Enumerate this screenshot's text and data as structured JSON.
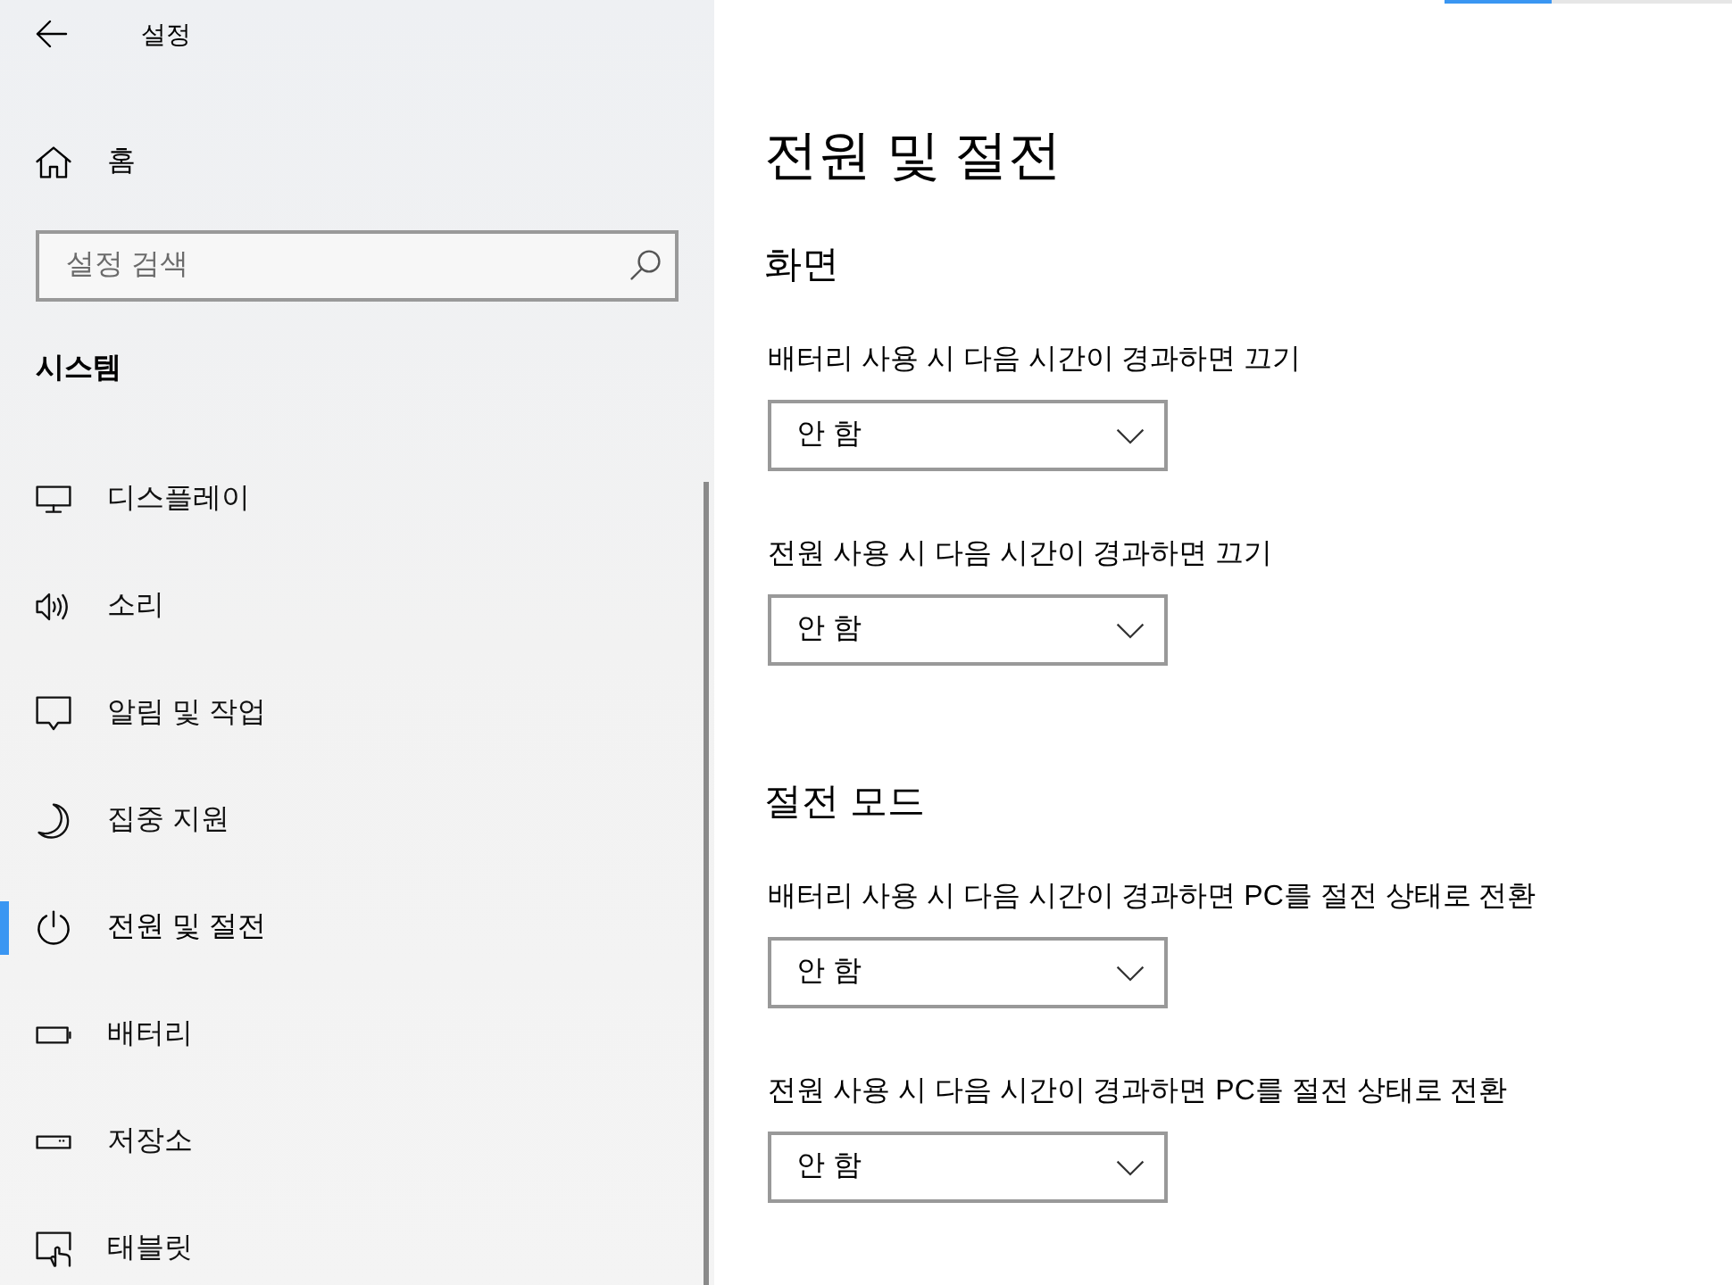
{
  "sidebar": {
    "title": "설정",
    "home": "홈",
    "search": {
      "placeholder": "설정 검색"
    },
    "section": "시스템",
    "items": [
      {
        "label": "디스플레이",
        "selected": false
      },
      {
        "label": "소리",
        "selected": false
      },
      {
        "label": "알림 및 작업",
        "selected": false
      },
      {
        "label": "집중 지원",
        "selected": false
      },
      {
        "label": "전원 및 절전",
        "selected": true
      },
      {
        "label": "배터리",
        "selected": false
      },
      {
        "label": "저장소",
        "selected": false
      },
      {
        "label": "태블릿",
        "selected": false
      }
    ]
  },
  "progress": {
    "level": 0.37
  },
  "page": {
    "title": "전원 및 절전",
    "sections": [
      {
        "heading": "화면",
        "settings": [
          {
            "label": "배터리 사용 시 다음 시간이 경과하면 끄기",
            "value": "안 함"
          },
          {
            "label": "전원 사용 시 다음 시간이 경과하면 끄기",
            "value": "안 함"
          }
        ]
      },
      {
        "heading": "절전 모드",
        "settings": [
          {
            "label": "배터리 사용 시 다음 시간이 경과하면 PC를 절전 상태로 전환",
            "value": "안 함"
          },
          {
            "label": "전원 사용 시 다음 시간이 경과하면 PC를 절전 상태로 전환",
            "value": "안 함"
          }
        ]
      }
    ]
  }
}
